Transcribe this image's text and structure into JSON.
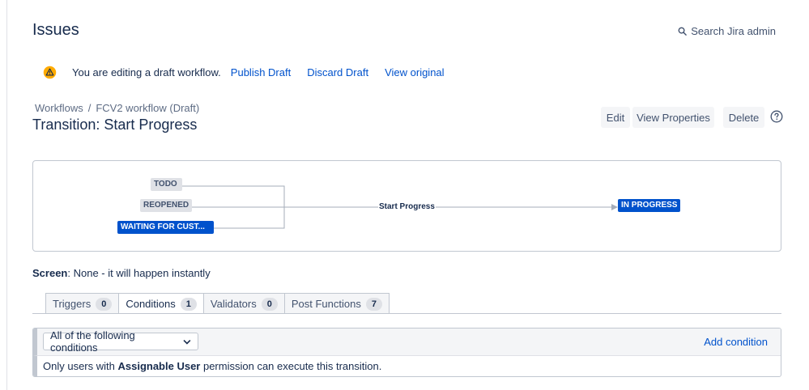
{
  "header": {
    "title": "Issues",
    "search_label": "Search Jira admin"
  },
  "notice": {
    "text": "You are editing a draft workflow.",
    "publish": "Publish Draft",
    "discard": "Discard Draft",
    "view_original": "View original"
  },
  "breadcrumb": {
    "root": "Workflows",
    "separator": "/",
    "current": "FCV2 workflow (Draft)"
  },
  "page": {
    "title": "Transition: Start Progress"
  },
  "actions": {
    "edit": "Edit",
    "view_properties": "View Properties",
    "delete": "Delete"
  },
  "diagram": {
    "from_statuses": [
      "TODO",
      "REOPENED",
      "WAITING FOR CUST..."
    ],
    "transition": "Start Progress",
    "to_status": "IN PROGRESS"
  },
  "screen": {
    "label": "Screen",
    "value": ": None - it will happen instantly"
  },
  "tabs": [
    {
      "label": "Triggers",
      "count": "0"
    },
    {
      "label": "Conditions",
      "count": "1"
    },
    {
      "label": "Validators",
      "count": "0"
    },
    {
      "label": "Post Functions",
      "count": "7"
    }
  ],
  "conditions": {
    "select_value": "All of the following conditions",
    "add_label": "Add condition",
    "rule_prefix": "Only users with ",
    "rule_bold": "Assignable User",
    "rule_suffix": " permission can execute this transition."
  },
  "colors": {
    "accent": "#0052cc",
    "text": "#172b4d",
    "warning": "#ffab00"
  }
}
